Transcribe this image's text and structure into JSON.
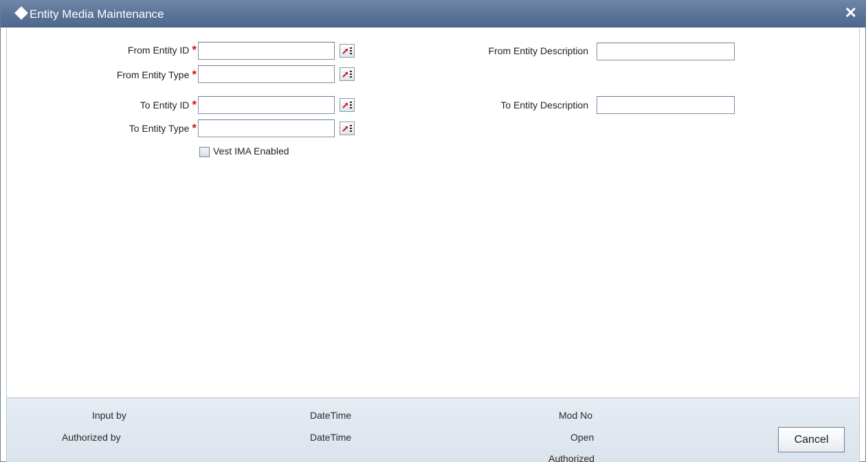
{
  "window": {
    "title": "Entity Media Maintenance",
    "close_glyph": "✕"
  },
  "form": {
    "from_entity_id": {
      "label": "From Entity ID",
      "value": ""
    },
    "from_entity_type": {
      "label": "From Entity Type",
      "value": ""
    },
    "to_entity_id": {
      "label": "To Entity ID",
      "value": ""
    },
    "to_entity_type": {
      "label": "To Entity Type",
      "value": ""
    },
    "from_entity_description": {
      "label": "From Entity Description",
      "value": ""
    },
    "to_entity_description": {
      "label": "To Entity Description",
      "value": ""
    },
    "required_marker": "*",
    "vest_ima": {
      "label": "Vest IMA Enabled",
      "checked": false
    }
  },
  "footer": {
    "input_by": "Input by",
    "authorized_by": "Authorized by",
    "datetime_1": "DateTime",
    "datetime_2": "DateTime",
    "mod_no": "Mod No",
    "open": "Open",
    "authorized": "Authorized",
    "cancel_label": "Cancel"
  },
  "colors": {
    "titlebar": "#5a7396",
    "required": "#d01414",
    "footer_bg": "#e0e7ef",
    "lov_arrow": "#c81e1e"
  },
  "icons": {
    "title": "diamond-icon",
    "close": "close-icon",
    "lov": "list-of-values-icon"
  }
}
